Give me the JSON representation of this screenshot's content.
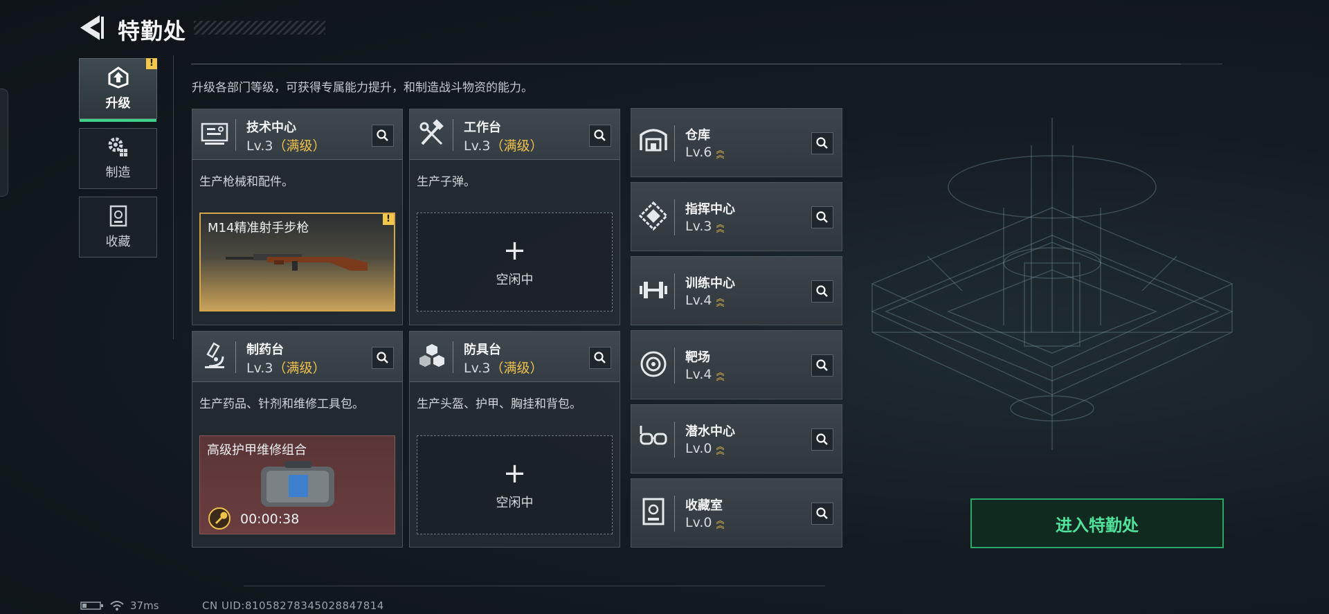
{
  "header": {
    "title": "特勤处"
  },
  "sidebar": {
    "tabs": [
      {
        "label": "升级",
        "active": true,
        "icon": "upgrade-icon",
        "alert": "!"
      },
      {
        "label": "制造",
        "active": false,
        "icon": "gears-icon"
      },
      {
        "label": "收藏",
        "active": false,
        "icon": "vault-icon"
      }
    ]
  },
  "main": {
    "description": "升级各部门等级，可获得专属能力提升，和制造战斗物资的能力。",
    "cards": [
      {
        "name": "技术中心",
        "level": "Lv.3",
        "max": "（满级）",
        "desc": "生产枪械和配件。",
        "icon": "monitor-icon",
        "item": {
          "name": "M14精准射手步枪",
          "alert": "!"
        }
      },
      {
        "name": "工作台",
        "level": "Lv.3",
        "max": "（满级）",
        "desc": "生产子弹。",
        "icon": "tools-icon",
        "slot": {
          "plus": "+",
          "label": "空闲中"
        }
      },
      {
        "name": "制药台",
        "level": "Lv.3",
        "max": "（满级）",
        "desc": "生产药品、针剂和维修工具包。",
        "icon": "microscope-icon",
        "item": {
          "name": "高级护甲维修组合",
          "timer": "00:00:38"
        }
      },
      {
        "name": "防具台",
        "level": "Lv.3",
        "max": "（满级）",
        "desc": "生产头盔、护甲、胸挂和背包。",
        "icon": "boxes-icon",
        "slot": {
          "plus": "+",
          "label": "空闲中"
        }
      }
    ]
  },
  "facilities": [
    {
      "name": "仓库",
      "level": "Lv.6",
      "icon": "warehouse-icon"
    },
    {
      "name": "指挥中心",
      "level": "Lv.3",
      "icon": "command-icon"
    },
    {
      "name": "训练中心",
      "level": "Lv.4",
      "icon": "dumbbell-icon"
    },
    {
      "name": "靶场",
      "level": "Lv.4",
      "icon": "target-icon"
    },
    {
      "name": "潜水中心",
      "level": "Lv.0",
      "icon": "goggles-icon"
    },
    {
      "name": "收藏室",
      "level": "Lv.0",
      "icon": "vault-icon"
    }
  ],
  "enter_button": "进入特勤处",
  "status": {
    "ping": "37ms",
    "uid": "CN UID:8105827834502884781​4"
  },
  "colors": {
    "accent_green": "#3fd08a",
    "gold": "#f0c14b"
  }
}
